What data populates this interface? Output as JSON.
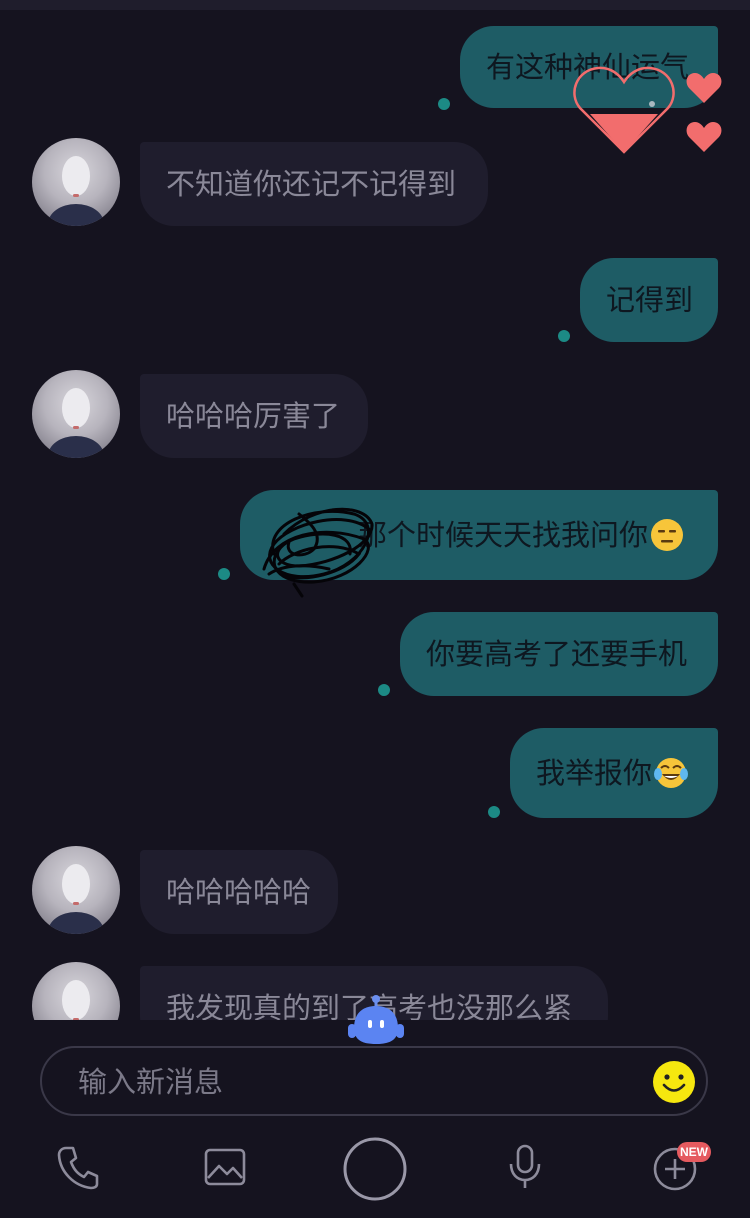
{
  "messages": [
    {
      "direction": "out",
      "text": "有这种神仙运气"
    },
    {
      "direction": "in",
      "text": "不知道你还记不记得到"
    },
    {
      "direction": "out",
      "text": "记得到"
    },
    {
      "direction": "in",
      "text": "哈哈哈厉害了"
    },
    {
      "direction": "out",
      "text": "那个时候天天找我问你",
      "emoji": "expressionless-face-emoji"
    },
    {
      "direction": "out",
      "text": "你要高考了还要手机"
    },
    {
      "direction": "out",
      "text": "我举报你",
      "emoji": "tears-of-joy-emoji"
    },
    {
      "direction": "in",
      "text": "哈哈哈哈哈"
    },
    {
      "direction": "in",
      "text": "我发现真的到了高考也没那么紧"
    }
  ],
  "composer": {
    "placeholder": "输入新消息"
  },
  "toolbar": {
    "icons": [
      "phone-icon",
      "image-icon",
      "home-circle-icon",
      "microphone-icon",
      "plus-circle-icon"
    ],
    "badge": "NEW"
  },
  "colors": {
    "background": "#15131f",
    "outgoing_bubble": "#1e5c65",
    "incoming_bubble": "#1f1d2d",
    "heart": "#f26d6d",
    "badge": "#e55a5f"
  }
}
